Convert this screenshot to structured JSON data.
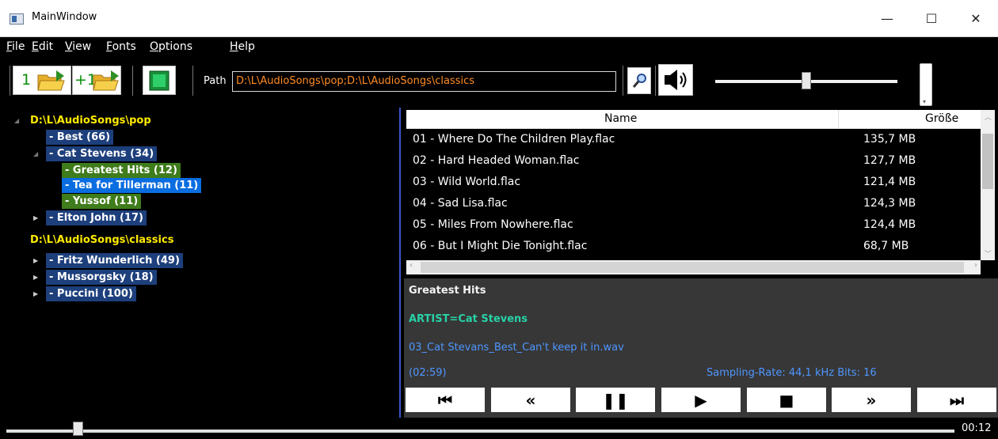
{
  "window": {
    "title": "MainWindow",
    "minimize": "—",
    "maximize": "☐",
    "close": "✕"
  },
  "menu": [
    "File",
    "Edit",
    "View",
    "Fonts",
    "Options",
    "Help"
  ],
  "menu_mnemonic": [
    "F",
    "E",
    "V",
    "F",
    "O",
    "H"
  ],
  "toolbar": {
    "open_label": "1",
    "add_label": "+1",
    "path_label": "Path",
    "path_value": "D:\\L\\AudioSongs\\pop;D:\\L\\AudioSongs\\classics",
    "volume_level": 0.5
  },
  "tree": [
    {
      "label": "D:\\L\\AudioSongs\\pop",
      "style": "root",
      "depth": 0,
      "expanded": true
    },
    {
      "label": "- Best (66)",
      "style": "blue",
      "depth": 1
    },
    {
      "label": "- Cat Stevens (34)",
      "style": "blue",
      "depth": 1,
      "expanded": true
    },
    {
      "label": "- Greatest Hits (12)",
      "style": "green",
      "depth": 2
    },
    {
      "label": "- Tea for Tillerman (11)",
      "style": "selected",
      "depth": 2
    },
    {
      "label": "- Yussof (11)",
      "style": "green",
      "depth": 2
    },
    {
      "label": "- Elton John (17)",
      "style": "blue",
      "depth": 1,
      "collapsed": true
    },
    {
      "label": "D:\\L\\AudioSongs\\classics",
      "style": "root",
      "depth": 0
    },
    {
      "label": "- Fritz Wunderlich (49)",
      "style": "blue",
      "depth": 1,
      "collapsed": true
    },
    {
      "label": "- Mussorgsky (18)",
      "style": "blue",
      "depth": 1,
      "collapsed": true
    },
    {
      "label": "- Puccini (100)",
      "style": "blue",
      "depth": 1,
      "collapsed": true
    }
  ],
  "filelist": {
    "columns": [
      "Name",
      "Größe"
    ],
    "rows": [
      {
        "name": "01 - Where Do The Children Play.flac",
        "size": "135,7 MB"
      },
      {
        "name": "02 - Hard Headed Woman.flac",
        "size": "127,7 MB"
      },
      {
        "name": "03 - Wild World.flac",
        "size": "121,4 MB"
      },
      {
        "name": "04 - Sad Lisa.flac",
        "size": "124,3 MB"
      },
      {
        "name": "05 - Miles From Nowhere.flac",
        "size": "124,4 MB"
      },
      {
        "name": "06 - But I Might Die Tonight.flac",
        "size": "68,7 MB"
      }
    ]
  },
  "info": {
    "album": "Greatest Hits",
    "artist": "ARTIST=Cat Stevens",
    "file": "03_Cat Stevans_Best_Can't keep it in.wav",
    "duration": "(02:59)",
    "sampling": "Sampling-Rate: 44,1 kHz  Bits: 16"
  },
  "player_buttons": [
    {
      "name": "previous-track-button",
      "glyph": "⏮"
    },
    {
      "name": "rewind-button",
      "glyph": "«"
    },
    {
      "name": "pause-button",
      "glyph": "❚❚"
    },
    {
      "name": "play-button",
      "glyph": "▶"
    },
    {
      "name": "stop-button",
      "glyph": "■"
    },
    {
      "name": "fast-forward-button",
      "glyph": "»"
    },
    {
      "name": "next-track-button",
      "glyph": "⏭"
    }
  ],
  "position": {
    "time": "00:12",
    "fraction": 0.075
  }
}
